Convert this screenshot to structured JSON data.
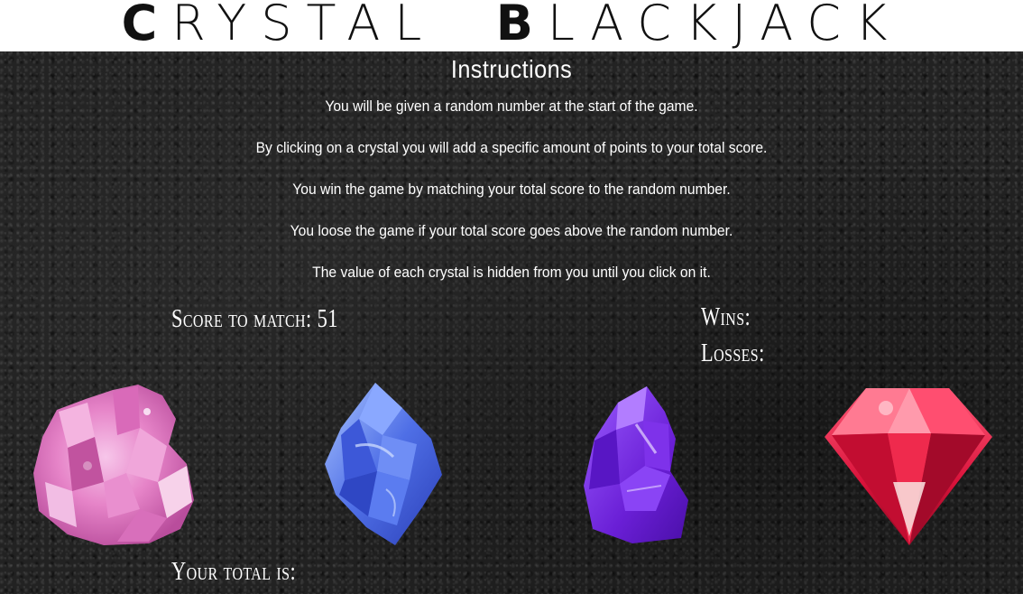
{
  "header": {
    "title_first_cap": "C",
    "title_first_rest": "RYSTAL",
    "title_second_cap": "B",
    "title_second_rest": "LACKJACK"
  },
  "instructions": {
    "heading": "Instructions",
    "lines": [
      "You will be given a random number at the start of the game.",
      "By clicking on a crystal you will add a specific amount of points to your total score.",
      "You win the game by matching your total score to the random number.",
      "You loose the game if your total score goes above the random number.",
      "The value of each crystal is hidden from you until you click on it."
    ]
  },
  "scoreboard": {
    "score_to_match_label": "Score to match:",
    "score_to_match_value": "51",
    "wins_label": "Wins:",
    "losses_label": "Losses:",
    "total_label": "Your total is:"
  },
  "crystals": [
    {
      "name": "pink-amethyst-crystal",
      "color": "#e88acb"
    },
    {
      "name": "blue-crystal",
      "color": "#4f6fe6"
    },
    {
      "name": "purple-crystal",
      "color": "#6a1fd6"
    },
    {
      "name": "red-diamond-crystal",
      "color": "#e0183c"
    }
  ]
}
